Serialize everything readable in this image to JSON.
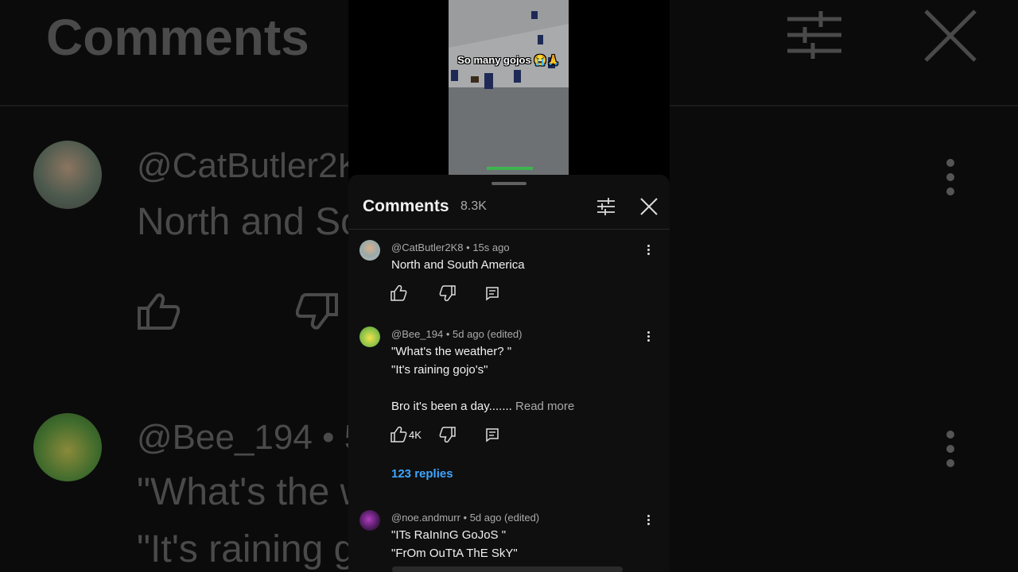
{
  "background": {
    "title": "Comments",
    "comment1": {
      "author": "@CatButler2K",
      "text": "North and So"
    },
    "comment2": {
      "author": "@Bee_194 • 5d",
      "line1": "\"What's the w",
      "line2": "\"It's raining g"
    }
  },
  "video": {
    "caption": "So many gojos 😭🙏"
  },
  "sheet": {
    "title": "Comments",
    "count": "8.3K",
    "filter_icon": "tune-icon",
    "close_icon": "close-icon"
  },
  "comments": [
    {
      "author": "@CatButler2K8",
      "time": "15s ago",
      "lines": [
        "North and South America"
      ],
      "likes": "",
      "replies": ""
    },
    {
      "author": "@Bee_194",
      "time": "5d ago (edited)",
      "lines": [
        "\"What's the weather? \"",
        "\"It's raining gojo's\"",
        "",
        "Bro it's been a day......."
      ],
      "read_more": "Read more",
      "likes": "4K",
      "replies": "123 replies"
    },
    {
      "author": "@noe.andmurr",
      "time": "5d ago (edited)",
      "lines": [
        "\"ITs RaInInG GoJoS \"",
        "\"FrOm OuTtA ThE SkY\""
      ],
      "likes": "",
      "replies": ""
    }
  ],
  "colors": {
    "accent_link": "#3ea6ff",
    "sheet_bg": "#0f0f0f",
    "meta_text": "#aaaaaa"
  }
}
